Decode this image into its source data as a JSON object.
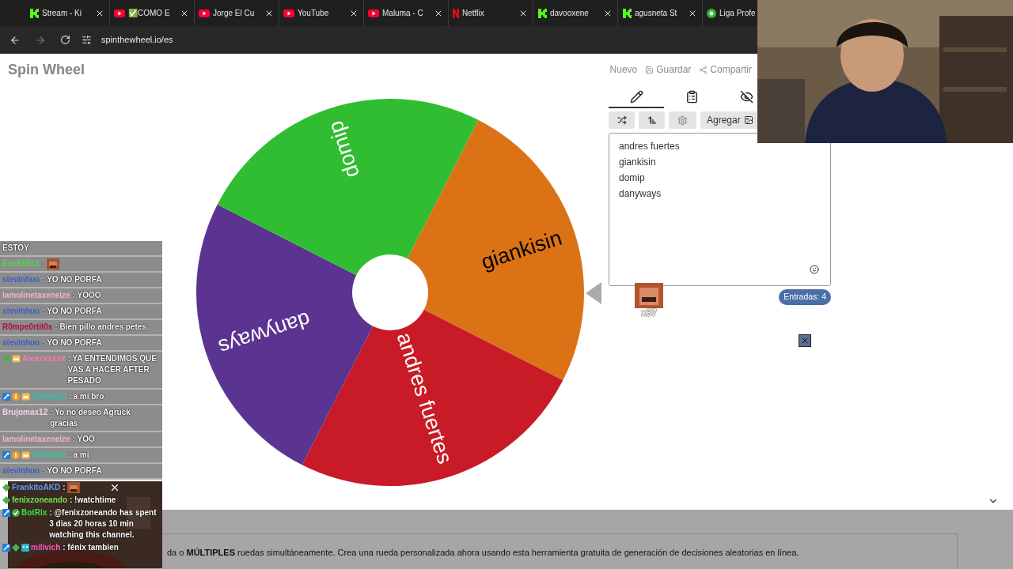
{
  "browser": {
    "tabs": [
      {
        "title": "Stream - Ki",
        "kind": "k"
      },
      {
        "title": "✅COMO E",
        "kind": "yt"
      },
      {
        "title": "Jorge El Cu",
        "kind": "yt"
      },
      {
        "title": "YouTube",
        "kind": "yt"
      },
      {
        "title": "Maluma - C",
        "kind": "yt"
      },
      {
        "title": "Netflix",
        "kind": "nf"
      },
      {
        "title": "davooxene",
        "kind": "k"
      },
      {
        "title": "agusneta St",
        "kind": "k"
      },
      {
        "title": "Liga Profe",
        "kind": "ball"
      }
    ],
    "url": "spinthewheel.io/es"
  },
  "header": {
    "logo": "Spin Wheel",
    "actions": [
      "Nuevo",
      "Guardar",
      "Compartir"
    ]
  },
  "wheel": {
    "segments": [
      {
        "label": "giankisin",
        "color": "#dc7216"
      },
      {
        "label": "andres fuertes",
        "color": "#c81a27"
      },
      {
        "label": "danyways",
        "color": "#5b3491"
      },
      {
        "label": "domip",
        "color": "#31bd31"
      }
    ]
  },
  "panel": {
    "tabs": [
      {
        "kind": "pencil",
        "selected": true
      },
      {
        "kind": "clipboard",
        "selected": false
      },
      {
        "kind": "eye-off",
        "selected": false
      }
    ],
    "add_button": "Agregar",
    "entries": [
      "andres fuertes",
      "giankisin",
      "domip",
      "danyways"
    ],
    "count": "Entradas: 4"
  },
  "alert": {
    "label": "x37"
  },
  "bottom": {
    "text": "da o **MÚLTIPLES** ruedas simultáneamente. Crea una rueda personalizada ahora usando esta herramienta gratuita de generación de decisiones aleatorias en línea."
  },
  "chat": {
    "messages": [
      {
        "text": "ESTOY"
      },
      {
        "user": "Erick5013",
        "color": "#4cd94c",
        "text": ":",
        "emote": true
      },
      {
        "user": "stevinhuo",
        "color": "#3a5fc8",
        "text": ": YO NO PORFA"
      },
      {
        "user": "lamolinetaxeneize",
        "color": "#f0b0d0",
        "text": ": YOOO"
      },
      {
        "user": "stevinhuo",
        "color": "#3a5fc8",
        "text": ": YO NO PORFA"
      },
      {
        "user": "R0mpe0rtit0s",
        "color": "#b0103a",
        "text": ": Bien pillo andres petes"
      },
      {
        "user": "stevinhuo",
        "color": "#3a5fc8",
        "text": ": YO NO PORFA"
      },
      {
        "user": "Alexxxxxxx",
        "color": "#ff7aa8",
        "text": ": YA ENTENDIMOS QUE VAS A HACER AFTER PESADO",
        "badges": [
          {
            "kind": "gem"
          },
          {
            "kind": "crown"
          }
        ]
      },
      {
        "user": "Zethaaa1",
        "color": "#2ec4a0",
        "text": ": a mi bro",
        "badges": [
          {
            "kind": "wrench"
          },
          {
            "kind": "coin"
          },
          {
            "kind": "crown"
          }
        ]
      },
      {
        "user": "Brujomax12",
        "color": "#f0d0e0",
        "text": ": Yo no deseo Agruck gracias"
      },
      {
        "user": "lamolinetaxeneize",
        "color": "#f0b0d0",
        "text": ": YOO"
      },
      {
        "user": "Zethaaa1",
        "color": "#2ec4a0",
        "text": ": a mi",
        "badges": [
          {
            "kind": "wrench"
          },
          {
            "kind": "coin"
          },
          {
            "kind": "crown"
          }
        ]
      },
      {
        "user": "stevinhuo",
        "color": "#3a5fc8",
        "text": ": YO NO PORFA"
      }
    ],
    "overlay_messages": [
      {
        "user": "FrankitoAKD",
        "color": "#5a9cff",
        "text": ":",
        "badges": [
          {
            "kind": "gem"
          }
        ],
        "emote": true
      },
      {
        "user": "fenixzoneando",
        "color": "#6ee04a",
        "text": ": !watchtime",
        "badges": [
          {
            "kind": "gem"
          }
        ]
      },
      {
        "user": "BotRix",
        "color": "#3fe03f",
        "text": ": @fenixzoneando has spent 3 dias 20 horas 10 min watching this channel.",
        "badges": [
          {
            "kind": "wrench"
          },
          {
            "kind": "check"
          }
        ]
      },
      {
        "user": "milivich",
        "color": "#ff55bb",
        "text": ": fénix tambien",
        "badges": [
          {
            "kind": "wrench"
          },
          {
            "kind": "gem"
          },
          {
            "kind": "bot"
          }
        ]
      }
    ]
  }
}
